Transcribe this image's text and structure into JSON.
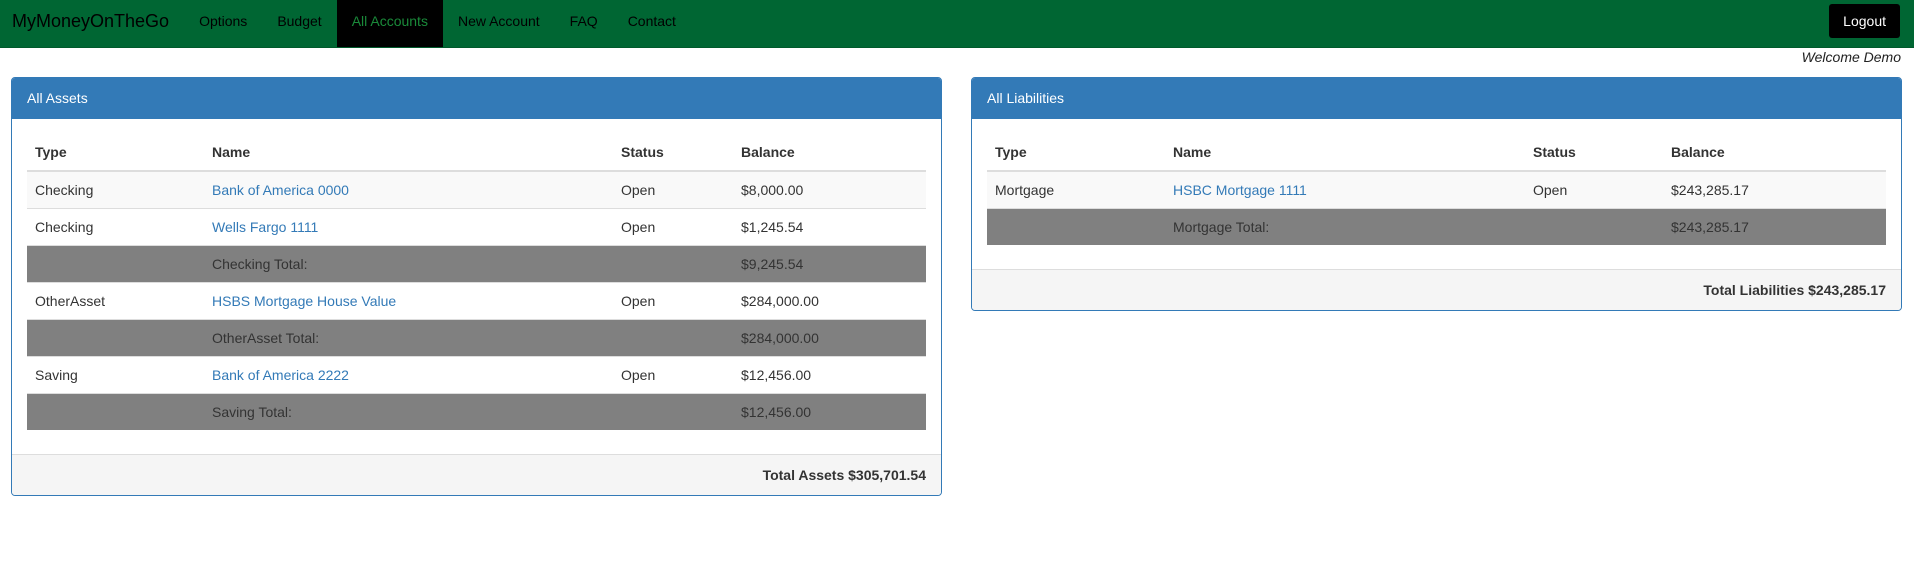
{
  "nav": {
    "brand": "MyMoneyOnTheGo",
    "items": [
      "Options",
      "Budget",
      "All Accounts",
      "New Account",
      "FAQ",
      "Contact"
    ],
    "active": "All Accounts",
    "logout": "Logout"
  },
  "welcome": "Welcome Demo",
  "assets": {
    "title": "All Assets",
    "headers": [
      "Type",
      "Name",
      "Status",
      "Balance"
    ],
    "rows": [
      {
        "type": "Checking",
        "name": "Bank of America 0000",
        "status": "Open",
        "balance": "$8,000.00"
      },
      {
        "type": "Checking",
        "name": "Wells Fargo 1111",
        "status": "Open",
        "balance": "$1,245.54"
      },
      {
        "label": "Checking Total:",
        "balance": "$9,245.54"
      },
      {
        "type": "OtherAsset",
        "name": "HSBS Mortgage House Value",
        "status": "Open",
        "balance": "$284,000.00"
      },
      {
        "label": "OtherAsset Total:",
        "balance": "$284,000.00"
      },
      {
        "type": "Saving",
        "name": "Bank of America 2222",
        "status": "Open",
        "balance": "$12,456.00"
      },
      {
        "label": "Saving Total:",
        "balance": "$12,456.00"
      }
    ],
    "footer": "Total Assets $305,701.54"
  },
  "liabilities": {
    "title": "All Liabilities",
    "headers": [
      "Type",
      "Name",
      "Status",
      "Balance"
    ],
    "rows": [
      {
        "type": "Mortgage",
        "name": "HSBC Mortgage 1111",
        "status": "Open",
        "balance": "$243,285.17"
      },
      {
        "label": "Mortgage Total:",
        "balance": "$243,285.17"
      }
    ],
    "footer": "Total Liabilities $243,285.17"
  },
  "colors": {
    "navbar": "#006633",
    "panel": "#337ab7",
    "total_row": "#808080",
    "link": "#337ab7"
  }
}
